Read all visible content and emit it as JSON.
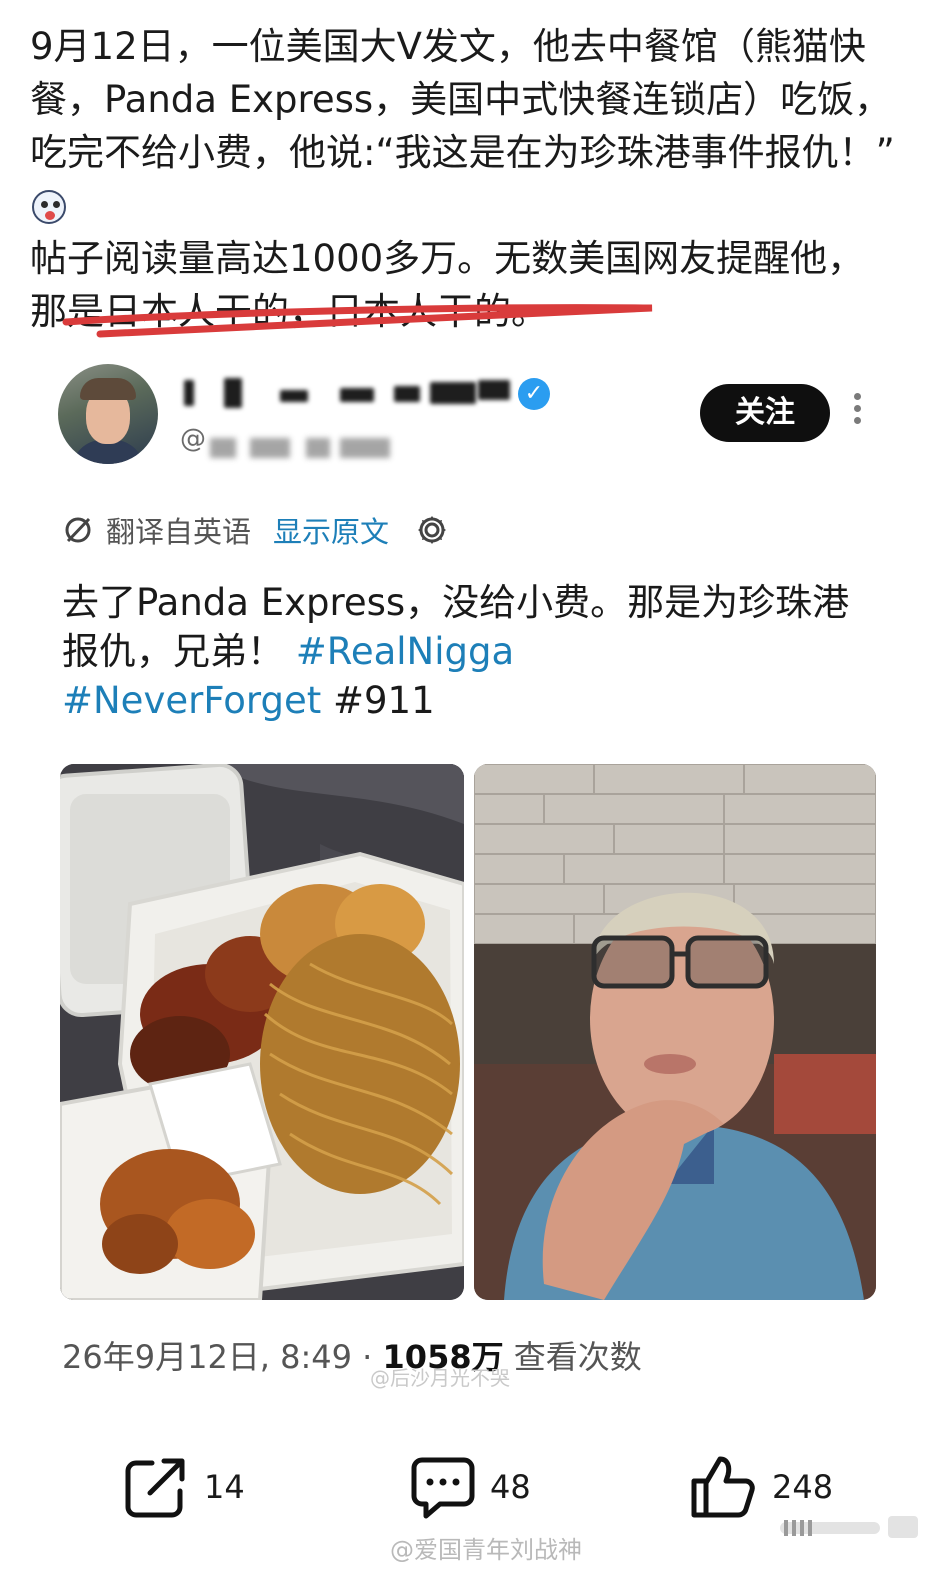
{
  "caption": {
    "line1": "9月12日，一位美国大V发文，他去中餐馆（熊猫快餐，Panda Express，美国中式快餐连锁店）吃饭，吃完不给小费，他说:“我这是在为珍珠港事件报仇！”",
    "line2": "帖子阅读量高达1000多万。无数美国网友提醒他，那是日本人干的，日本人干的。"
  },
  "user": {
    "handle_prefix": "@"
  },
  "follow_label": "关注",
  "translation": {
    "label": "翻译自英语",
    "show_original": "显示原文"
  },
  "tweet": {
    "text": "去了Panda Express，没给小费。那是为珍珠港报仇，兄弟！",
    "hashtags": [
      "#RealNigga",
      "#NeverForget",
      "#911"
    ]
  },
  "meta": {
    "date_time": "26年9月12日, 8:49 · ",
    "views_count": "1058万",
    "views_label": " 查看次数"
  },
  "actions": {
    "share_count": "14",
    "comment_count": "48",
    "like_count": "248"
  },
  "watermarks": {
    "middle": "@后沙月光不哭",
    "bottom": "@爱国青年刘战神"
  }
}
